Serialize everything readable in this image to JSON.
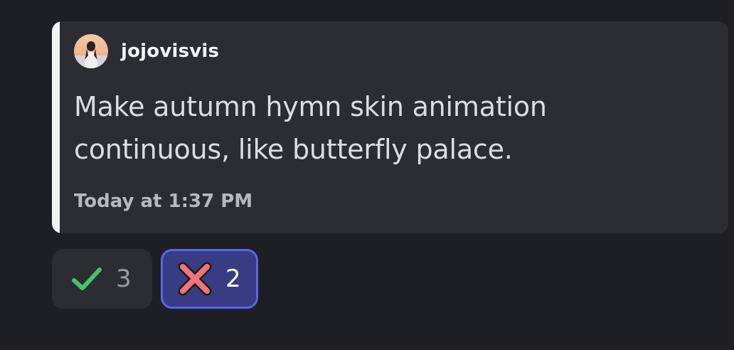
{
  "embed": {
    "author": {
      "name": "jojovisvis",
      "avatar_icon": "user-avatar-icon"
    },
    "description": "Make autumn hymn skin animation continuous, like butterfly palace.",
    "footer": "Today at 1:37 PM",
    "accent_color": "#f2f3f5"
  },
  "reactions": [
    {
      "emoji": "check-mark-icon",
      "count": "3",
      "selected": false,
      "color": "#45c46a"
    },
    {
      "emoji": "cross-mark-icon",
      "count": "2",
      "selected": true,
      "color": "#f07478"
    }
  ],
  "colors": {
    "background": "#1e1f24",
    "embed_background": "#2b2d33",
    "selected_reaction_bg": "#383c82",
    "selected_reaction_border": "#5865f2"
  }
}
